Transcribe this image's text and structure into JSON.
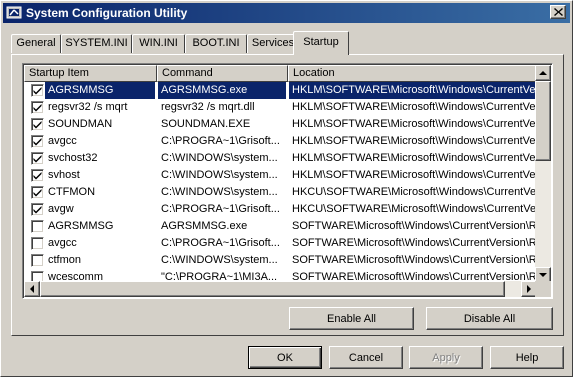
{
  "window": {
    "title": "System Configuration Utility"
  },
  "tabs": [
    {
      "label": "General",
      "active": false
    },
    {
      "label": "SYSTEM.INI",
      "active": false
    },
    {
      "label": "WIN.INI",
      "active": false
    },
    {
      "label": "BOOT.INI",
      "active": false
    },
    {
      "label": "Services",
      "active": false
    },
    {
      "label": "Startup",
      "active": true
    }
  ],
  "startup_list": {
    "columns": [
      "Startup Item",
      "Command",
      "Location"
    ],
    "rows": [
      {
        "checked": true,
        "item": "AGRSMMSG",
        "command": "AGRSMMSG.exe",
        "location": "HKLM\\SOFTWARE\\Microsoft\\Windows\\CurrentVer...",
        "selected": true
      },
      {
        "checked": true,
        "item": "regsvr32 /s mqrt",
        "command": "regsvr32 /s mqrt.dll",
        "location": "HKLM\\SOFTWARE\\Microsoft\\Windows\\CurrentVer...",
        "selected": false
      },
      {
        "checked": true,
        "item": "SOUNDMAN",
        "command": "SOUNDMAN.EXE",
        "location": "HKLM\\SOFTWARE\\Microsoft\\Windows\\CurrentVer...",
        "selected": false
      },
      {
        "checked": true,
        "item": "avgcc",
        "command": "C:\\PROGRA~1\\Grisoft...",
        "location": "HKLM\\SOFTWARE\\Microsoft\\Windows\\CurrentVer...",
        "selected": false
      },
      {
        "checked": true,
        "item": "svchost32",
        "command": "C:\\WINDOWS\\system...",
        "location": "HKLM\\SOFTWARE\\Microsoft\\Windows\\CurrentVer...",
        "selected": false
      },
      {
        "checked": true,
        "item": "svhost",
        "command": "C:\\WINDOWS\\system...",
        "location": "HKLM\\SOFTWARE\\Microsoft\\Windows\\CurrentVer...",
        "selected": false
      },
      {
        "checked": true,
        "item": "CTFMON",
        "command": "C:\\WINDOWS\\system...",
        "location": "HKCU\\SOFTWARE\\Microsoft\\Windows\\CurrentVer...",
        "selected": false
      },
      {
        "checked": true,
        "item": "avgw",
        "command": "C:\\PROGRA~1\\Grisoft...",
        "location": "HKCU\\SOFTWARE\\Microsoft\\Windows\\CurrentVer...",
        "selected": false
      },
      {
        "checked": false,
        "item": "AGRSMMSG",
        "command": "AGRSMMSG.exe",
        "location": "SOFTWARE\\Microsoft\\Windows\\CurrentVersion\\Ru...",
        "selected": false
      },
      {
        "checked": false,
        "item": "avgcc",
        "command": "C:\\PROGRA~1\\Grisoft...",
        "location": "SOFTWARE\\Microsoft\\Windows\\CurrentVersion\\Ru...",
        "selected": false
      },
      {
        "checked": false,
        "item": "ctfmon",
        "command": "C:\\WINDOWS\\system...",
        "location": "SOFTWARE\\Microsoft\\Windows\\CurrentVersion\\Ru...",
        "selected": false
      },
      {
        "checked": false,
        "item": "wcescomm",
        "command": "\"C:\\PROGRA~1\\MI3A...",
        "location": "SOFTWARE\\Microsoft\\Windows\\CurrentVersion\\Ru...",
        "selected": false
      }
    ]
  },
  "panel_buttons": {
    "enable_all": "Enable All",
    "disable_all": "Disable All"
  },
  "dialog_buttons": {
    "ok": "OK",
    "cancel": "Cancel",
    "apply": "Apply",
    "apply_enabled": false,
    "help": "Help"
  },
  "icons": {
    "app": "msconfig-app-icon",
    "close": "close-icon",
    "check": "checkmark-icon",
    "scroll_up": "arrow-up-icon",
    "scroll_down": "arrow-down-icon",
    "scroll_left": "arrow-left-icon",
    "scroll_right": "arrow-right-icon"
  },
  "colors": {
    "titlebar_start": "#0a246a",
    "titlebar_end": "#3a6ea5",
    "selection": "#0a246a",
    "face": "#d4d0c8"
  }
}
